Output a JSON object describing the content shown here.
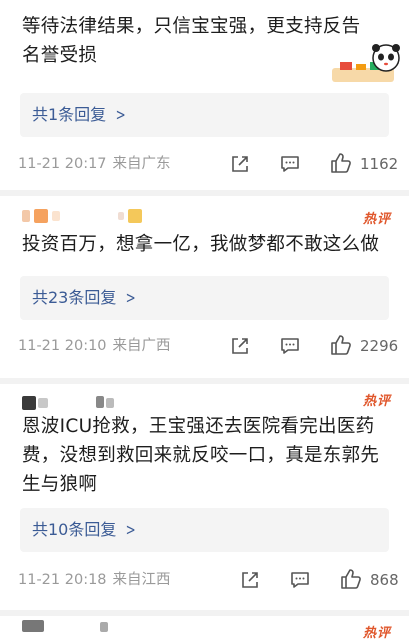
{
  "comments": [
    {
      "text_line1": "等待法律结果，只信宝宝强，更支持反告",
      "text_line2": "名誉受损",
      "reply_label": "共1条回复",
      "date": "11-21 20:17",
      "source": "来自广东",
      "likes": "1162"
    },
    {
      "hot": "热评",
      "text_line1": "投资百万，想拿一亿，我做梦都不敢这么做",
      "reply_label": "共23条回复",
      "date": "11-21 20:10",
      "source": "来自广西",
      "likes": "2296"
    },
    {
      "hot": "热评",
      "text_line1": "恩波ICU抢救，王宝强还去医院看完出医药",
      "text_line2": "费，没想到救回来就反咬一口，真是东郭先",
      "text_line3": "生与狼啊",
      "reply_label": "共10条回复",
      "date": "11-21 20:18",
      "source": "来自江西",
      "likes": "868"
    },
    {
      "hot": "热评"
    }
  ],
  "icons": {
    "share": "share-icon",
    "comment": "comment-icon",
    "like": "thumbs-up-icon",
    "chevron": "chevron-right-icon",
    "sticker": "panda-sticker-icon"
  },
  "colors": {
    "link": "#3b5b95",
    "hot": "#e0572c",
    "meta": "#9a9a9a",
    "reply_bg": "#f4f4f4"
  }
}
